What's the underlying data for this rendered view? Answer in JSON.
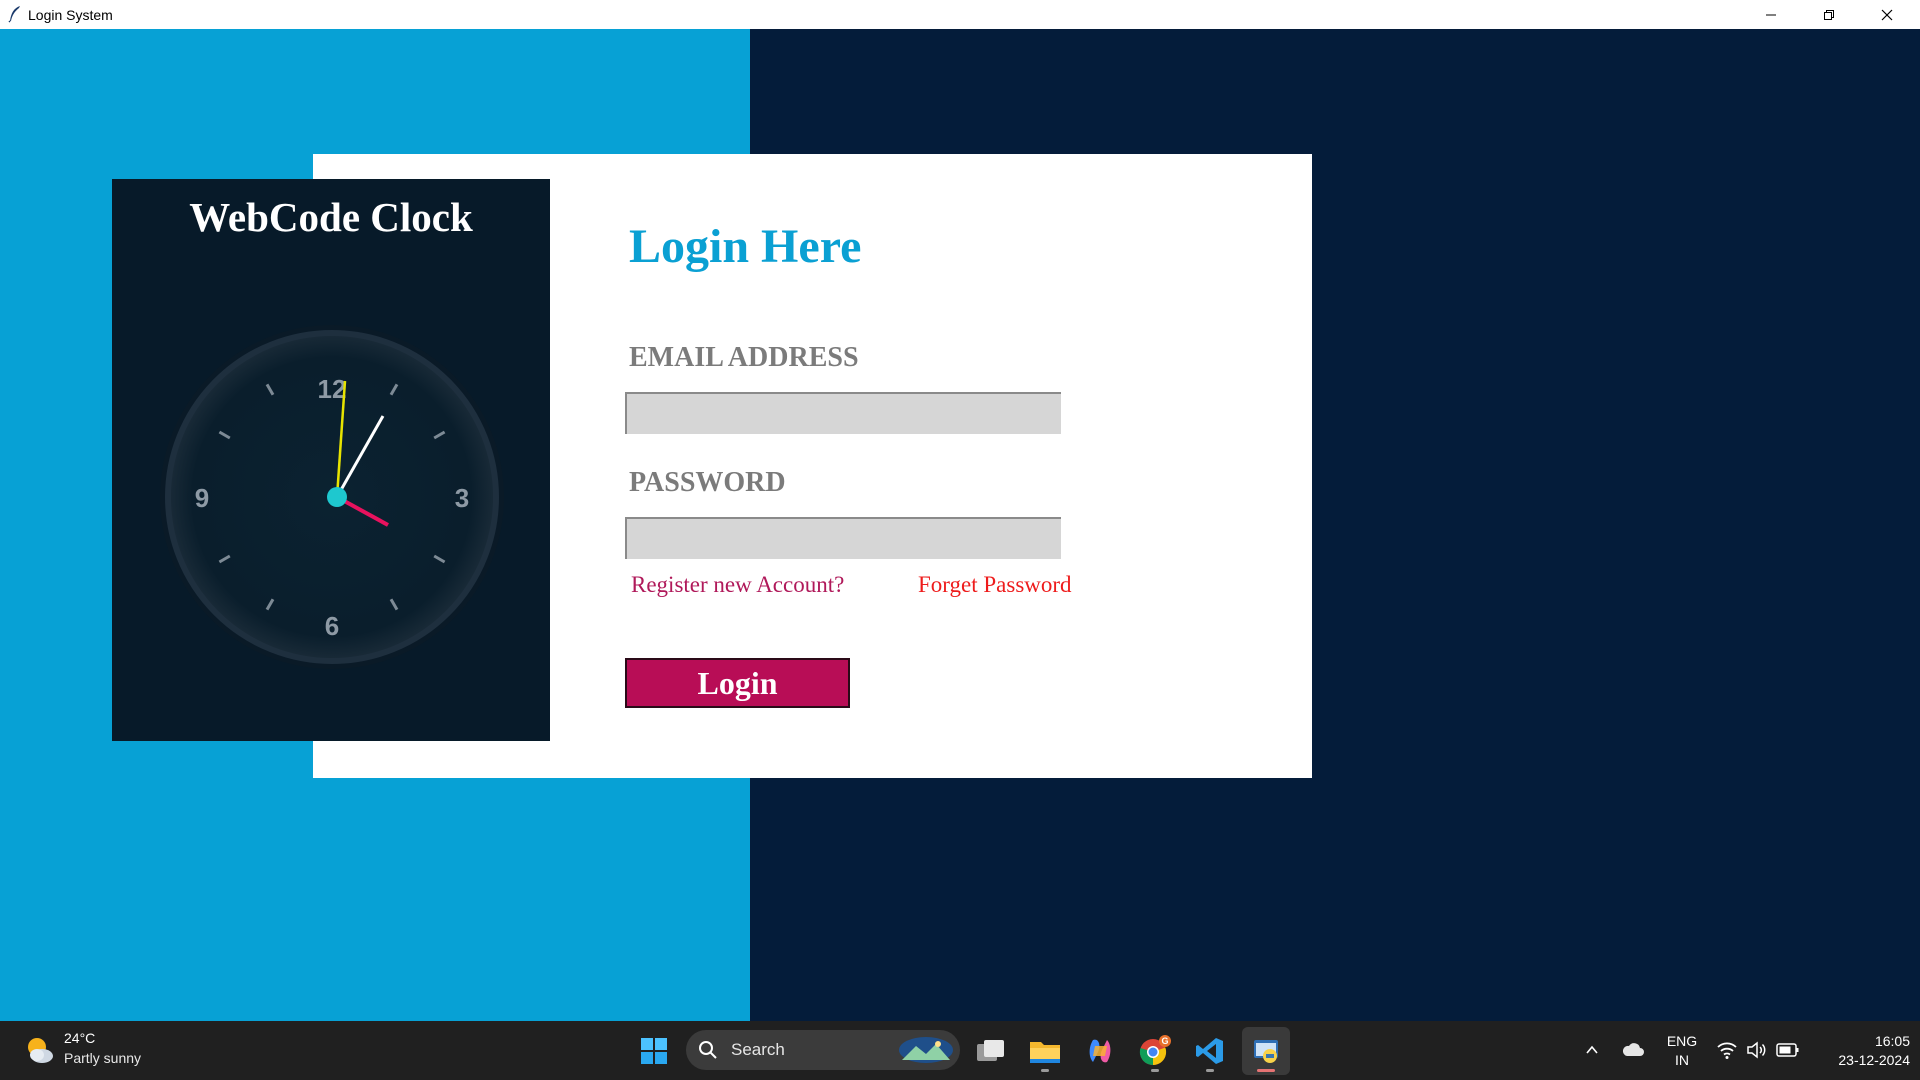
{
  "window": {
    "title": "Login System"
  },
  "clock": {
    "title": "WebCode Clock",
    "numbers": [
      "12",
      "3",
      "6",
      "9"
    ]
  },
  "login": {
    "heading": "Login Here",
    "email_label": "EMAIL ADDRESS",
    "email_value": "",
    "password_label": "PASSWORD",
    "password_value": "",
    "register_link": "Register new Account?",
    "forget_link": "Forget Password",
    "login_button": "Login"
  },
  "colors": {
    "left_panel": "#07a1d5",
    "right_panel": "#041c3a",
    "heading": "#0aa0d3",
    "button": "#b80d56",
    "forget_link": "#ee1c1c",
    "register_link": "#b0195a"
  },
  "taskbar": {
    "weather_temp": "24°C",
    "weather_condition": "Partly sunny",
    "search_label": "Search",
    "lang_top": "ENG",
    "lang_bottom": "IN",
    "time": "16:05",
    "date": "23-12-2024",
    "chrome_badge": "G",
    "apps": [
      "start-icon",
      "task-view-icon",
      "file-explorer-icon",
      "copilot-icon",
      "chrome-icon",
      "vscode-icon",
      "python-app-icon"
    ]
  }
}
